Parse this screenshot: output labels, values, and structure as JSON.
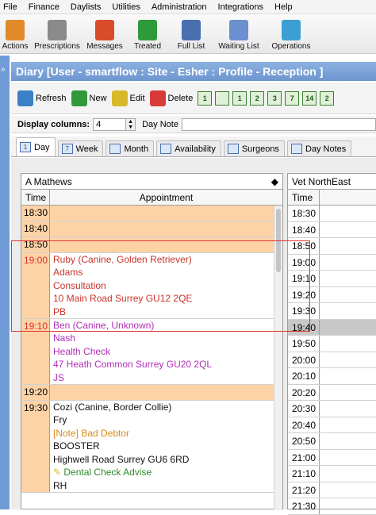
{
  "menu": [
    "File",
    "Finance",
    "Daylists",
    "Utilities",
    "Administration",
    "Integrations",
    "Help"
  ],
  "toolbar": [
    {
      "label": "Actions",
      "icon": "clipboard-icon",
      "color": "#e08a2a"
    },
    {
      "label": "Prescriptions",
      "icon": "prescription-icon",
      "color": "#8a8a8a"
    },
    {
      "label": "Messages",
      "icon": "messages-icon",
      "color": "#d84c2a"
    },
    {
      "label": "Treated",
      "icon": "treated-icon",
      "color": "#2f9a3a"
    },
    {
      "label": "Full List",
      "icon": "full-list-icon",
      "color": "#4a6fb0"
    },
    {
      "label": "Waiting List",
      "icon": "waiting-list-icon",
      "color": "#6c8fcf"
    },
    {
      "label": "Operations",
      "icon": "operations-icon",
      "color": "#3b9fd1"
    }
  ],
  "strip_label": "»",
  "title": "Diary [User - smartflow : Site - Esher : Profile - Reception ]",
  "actions": [
    {
      "label": "Refresh",
      "icon": "refresh-icon",
      "color": "#3b80c6"
    },
    {
      "label": "New",
      "icon": "new-grid-icon",
      "color": "#2f9a3a"
    },
    {
      "label": "Edit",
      "icon": "edit-icon",
      "color": "#d8b92a"
    },
    {
      "label": "Delete",
      "icon": "delete-icon",
      "color": "#d83a3a"
    }
  ],
  "day_buttons": [
    "1",
    "",
    "1",
    "2",
    "3",
    "7",
    "14",
    "2"
  ],
  "display_columns_label": "Display columns:",
  "display_columns_value": "4",
  "day_note_label": "Day Note",
  "tabs": [
    {
      "label": "Day",
      "icon": "1",
      "active": true
    },
    {
      "label": "Week",
      "icon": "7",
      "active": false
    },
    {
      "label": "Month",
      "icon": "",
      "active": false
    },
    {
      "label": "Availability",
      "icon": "",
      "active": false
    },
    {
      "label": "Surgeons",
      "icon": "",
      "active": false
    },
    {
      "label": "Day Notes",
      "icon": "",
      "active": false
    }
  ],
  "colA": {
    "resource": "A Mathews",
    "time_header": "Time",
    "appt_header": "Appointment",
    "rows": [
      {
        "time": "18:30",
        "lines": [],
        "empty": true
      },
      {
        "time": "18:40",
        "lines": [],
        "empty": true
      },
      {
        "time": "18:50",
        "lines": [],
        "empty": true
      },
      {
        "time": "19:00",
        "timecolor": "#d8322a",
        "lines": [
          {
            "text": "Ruby (Canine, Golden Retriever)",
            "color": "#c8342a"
          },
          {
            "text": "Adams",
            "color": "#c8342a"
          },
          {
            "text": "Consultation",
            "color": "#c8342a"
          },
          {
            "text": "10 Main Road Surrey GU12 2QE",
            "color": "#c8342a"
          },
          {
            "text": "PB",
            "color": "#c8342a"
          }
        ]
      },
      {
        "time": "19:10",
        "timecolor": "#d8322a",
        "lines": [
          {
            "text": "Ben (Canine, Unknown)",
            "color": "#b02fb5"
          },
          {
            "text": "Nash",
            "color": "#b02fb5"
          },
          {
            "text": "Health Check",
            "color": "#b02fb5"
          },
          {
            "text": "47 Heath Common Surrey GU20 2QL",
            "color": "#b02fb5"
          },
          {
            "text": "JS",
            "color": "#b02fb5"
          }
        ]
      },
      {
        "time": "19:20",
        "lines": [],
        "empty": true
      },
      {
        "time": "19:30",
        "lines": [
          {
            "text": "Cozi (Canine, Border Collie)",
            "color": "#111"
          },
          {
            "text": "Fry",
            "color": "#111"
          },
          {
            "text": "[Note] Bad Debtor",
            "color": "#d88a1a"
          },
          {
            "text": "BOOSTER",
            "color": "#111"
          },
          {
            "text": "Highwell Road Surrey GU6 6RD",
            "color": "#111"
          },
          {
            "text": "Dental Check Advise",
            "color": "#2c8a2c",
            "icon": true
          },
          {
            "text": "RH",
            "color": "#111"
          }
        ]
      }
    ]
  },
  "colB": {
    "resource": "Vet NorthEast",
    "time_header": "Time",
    "times": [
      "18:30",
      "18:40",
      "18:50",
      "19:00",
      "19:10",
      "19:20",
      "19:30",
      "19:40",
      "19:50",
      "20:00",
      "20:10",
      "20:20",
      "20:30",
      "20:40",
      "20:50",
      "21:00",
      "21:10",
      "21:20",
      "21:30"
    ],
    "grey_index": 7
  }
}
